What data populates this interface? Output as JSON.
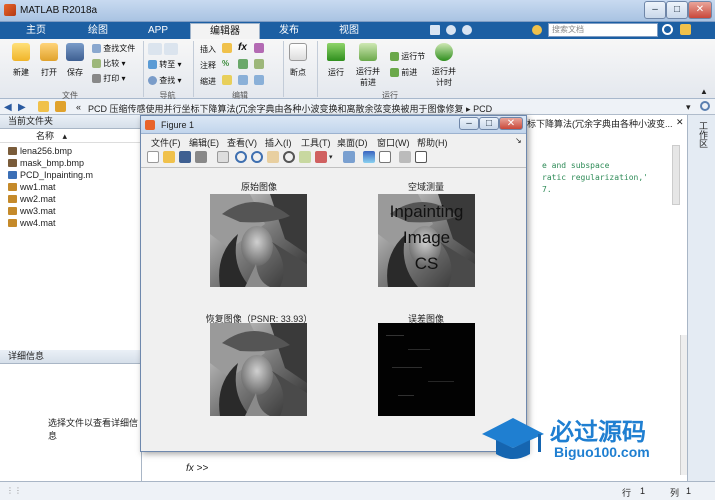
{
  "app": {
    "title": "MATLAB R2018a"
  },
  "window_buttons": {
    "minimize": "–",
    "maximize": "□",
    "close": "✕"
  },
  "tabs": [
    {
      "label": "主页"
    },
    {
      "label": "绘图"
    },
    {
      "label": "APP"
    },
    {
      "label": "编辑器"
    },
    {
      "label": "发布"
    },
    {
      "label": "视图"
    }
  ],
  "search": {
    "placeholder": "搜索文档"
  },
  "ribbon": {
    "file": {
      "new": "新建",
      "open": "打开",
      "save": "保存",
      "find_files": "查找文件",
      "compare": "比较",
      "print": "打印",
      "group": "文件"
    },
    "navigate": {
      "goto": "转至",
      "find": "查找",
      "group": "导航"
    },
    "edit": {
      "insert": "插入",
      "comment": "注释",
      "indent": "缩进",
      "fx": "fx",
      "group": "编辑"
    },
    "breakpoints": {
      "label": "断点"
    },
    "run": {
      "run": "运行",
      "run_advance_1": "运行并",
      "run_advance_2": "前进",
      "run_section": "运行节",
      "advance": "前进",
      "run_time_1": "运行并",
      "run_time_2": "计时",
      "group": "运行"
    }
  },
  "address": {
    "path": "PCD 压缩传感使用并行坐标下降算法(冗余字典由各种小波变换和离散余弦变换被用于图像修复",
    "arrow": "▸",
    "last": "PCD"
  },
  "current_folder": {
    "title": "当前文件夹",
    "column": "名称",
    "files": [
      {
        "name": "lena256.bmp",
        "color": "#7a5c3a"
      },
      {
        "name": "mask_bmp.bmp",
        "color": "#7a5c3a"
      },
      {
        "name": "PCD_Inpainting.m",
        "color": "#3b6fb6"
      },
      {
        "name": "ww1.mat",
        "color": "#c58a2a"
      },
      {
        "name": "ww2.mat",
        "color": "#c58a2a"
      },
      {
        "name": "ww3.mat",
        "color": "#c58a2a"
      },
      {
        "name": "ww4.mat",
        "color": "#c58a2a"
      }
    ]
  },
  "details": {
    "title": "详细信息",
    "message": "选择文件以查看详细信息"
  },
  "command": {
    "behind_title": "标下降算法(冗余字典由各种小波变...",
    "lines": [
      "e and subspace",
      "ratic regularization,'",
      "7."
    ],
    "prompt": "fx >>"
  },
  "right_rail": {
    "label": "工作区"
  },
  "statusbar": {
    "row_label": "行",
    "row": "1",
    "col_label": "列",
    "col": "1"
  },
  "figure": {
    "title": "Figure 1",
    "menu": [
      "文件(F)",
      "编辑(E)",
      "查看(V)",
      "插入(I)",
      "工具(T)",
      "桌面(D)",
      "窗口(W)",
      "帮助(H)"
    ],
    "subplots": [
      {
        "title": "原始图像"
      },
      {
        "title": "空域测量",
        "overlay": [
          "Inpainting",
          "Image",
          "CS"
        ]
      },
      {
        "title": "恢复图像（PSNR: 33.93）"
      },
      {
        "title": "误差图像"
      }
    ]
  },
  "watermark": {
    "text1": "必过源码",
    "text2": "Biguo100.com"
  },
  "colors": {
    "accent": "#1c5fa3",
    "titlebar": "#b9cfe9"
  }
}
